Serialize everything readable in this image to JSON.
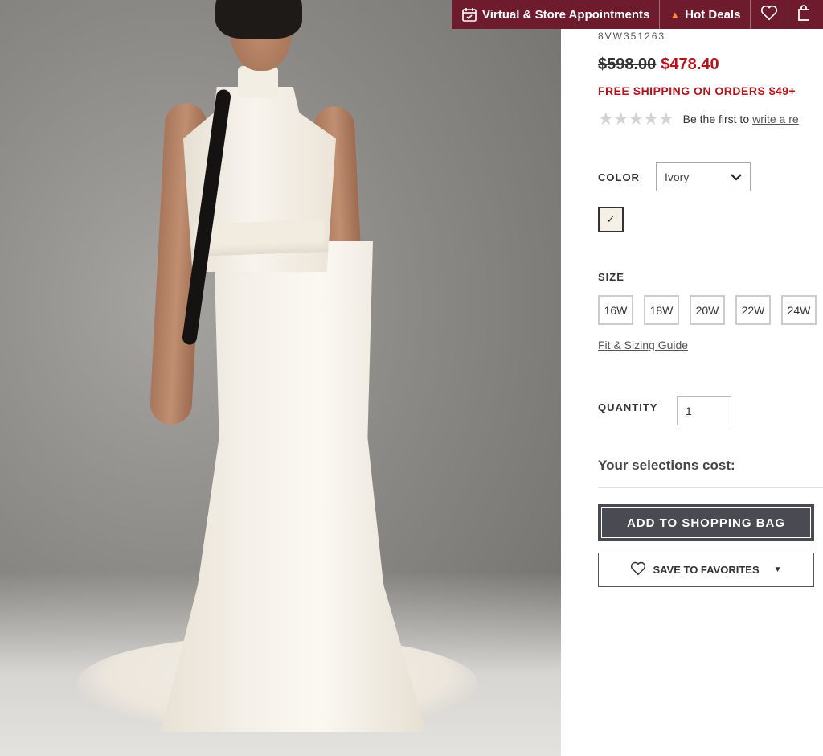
{
  "topbar": {
    "appointments_label": "Virtual & Store Appointments",
    "hot_deals_label": "Hot Deals",
    "icons": [
      "calendar-icon",
      "flame-icon",
      "heart-icon",
      "bag-icon"
    ]
  },
  "product": {
    "sku": "8VW351263",
    "original_price": "$598.00",
    "sale_price": "$478.40",
    "shipping_note": "FREE SHIPPING ON ORDERS $49+",
    "rating_stars": 0,
    "review_prompt": "Be the first to",
    "review_link": "write a re"
  },
  "color": {
    "label": "COLOR",
    "selected": "Ivory",
    "swatch_color": "#f5f0e6",
    "swatch_check": "✓"
  },
  "size": {
    "label": "SIZE",
    "options": [
      "16W",
      "18W",
      "20W",
      "22W",
      "24W"
    ],
    "guide_link": "Fit & Sizing Guide"
  },
  "quantity": {
    "label": "QUANTITY",
    "value": "1"
  },
  "summary": {
    "cost_label": "Your selections cost:"
  },
  "actions": {
    "add_to_bag": "ADD TO SHOPPING BAG",
    "save_favorites": "SAVE TO FAVORITES"
  },
  "colors": {
    "topbar_bg": "#6e1b2e",
    "sale_red": "#b5121b",
    "button_dark": "#4a4a52"
  }
}
